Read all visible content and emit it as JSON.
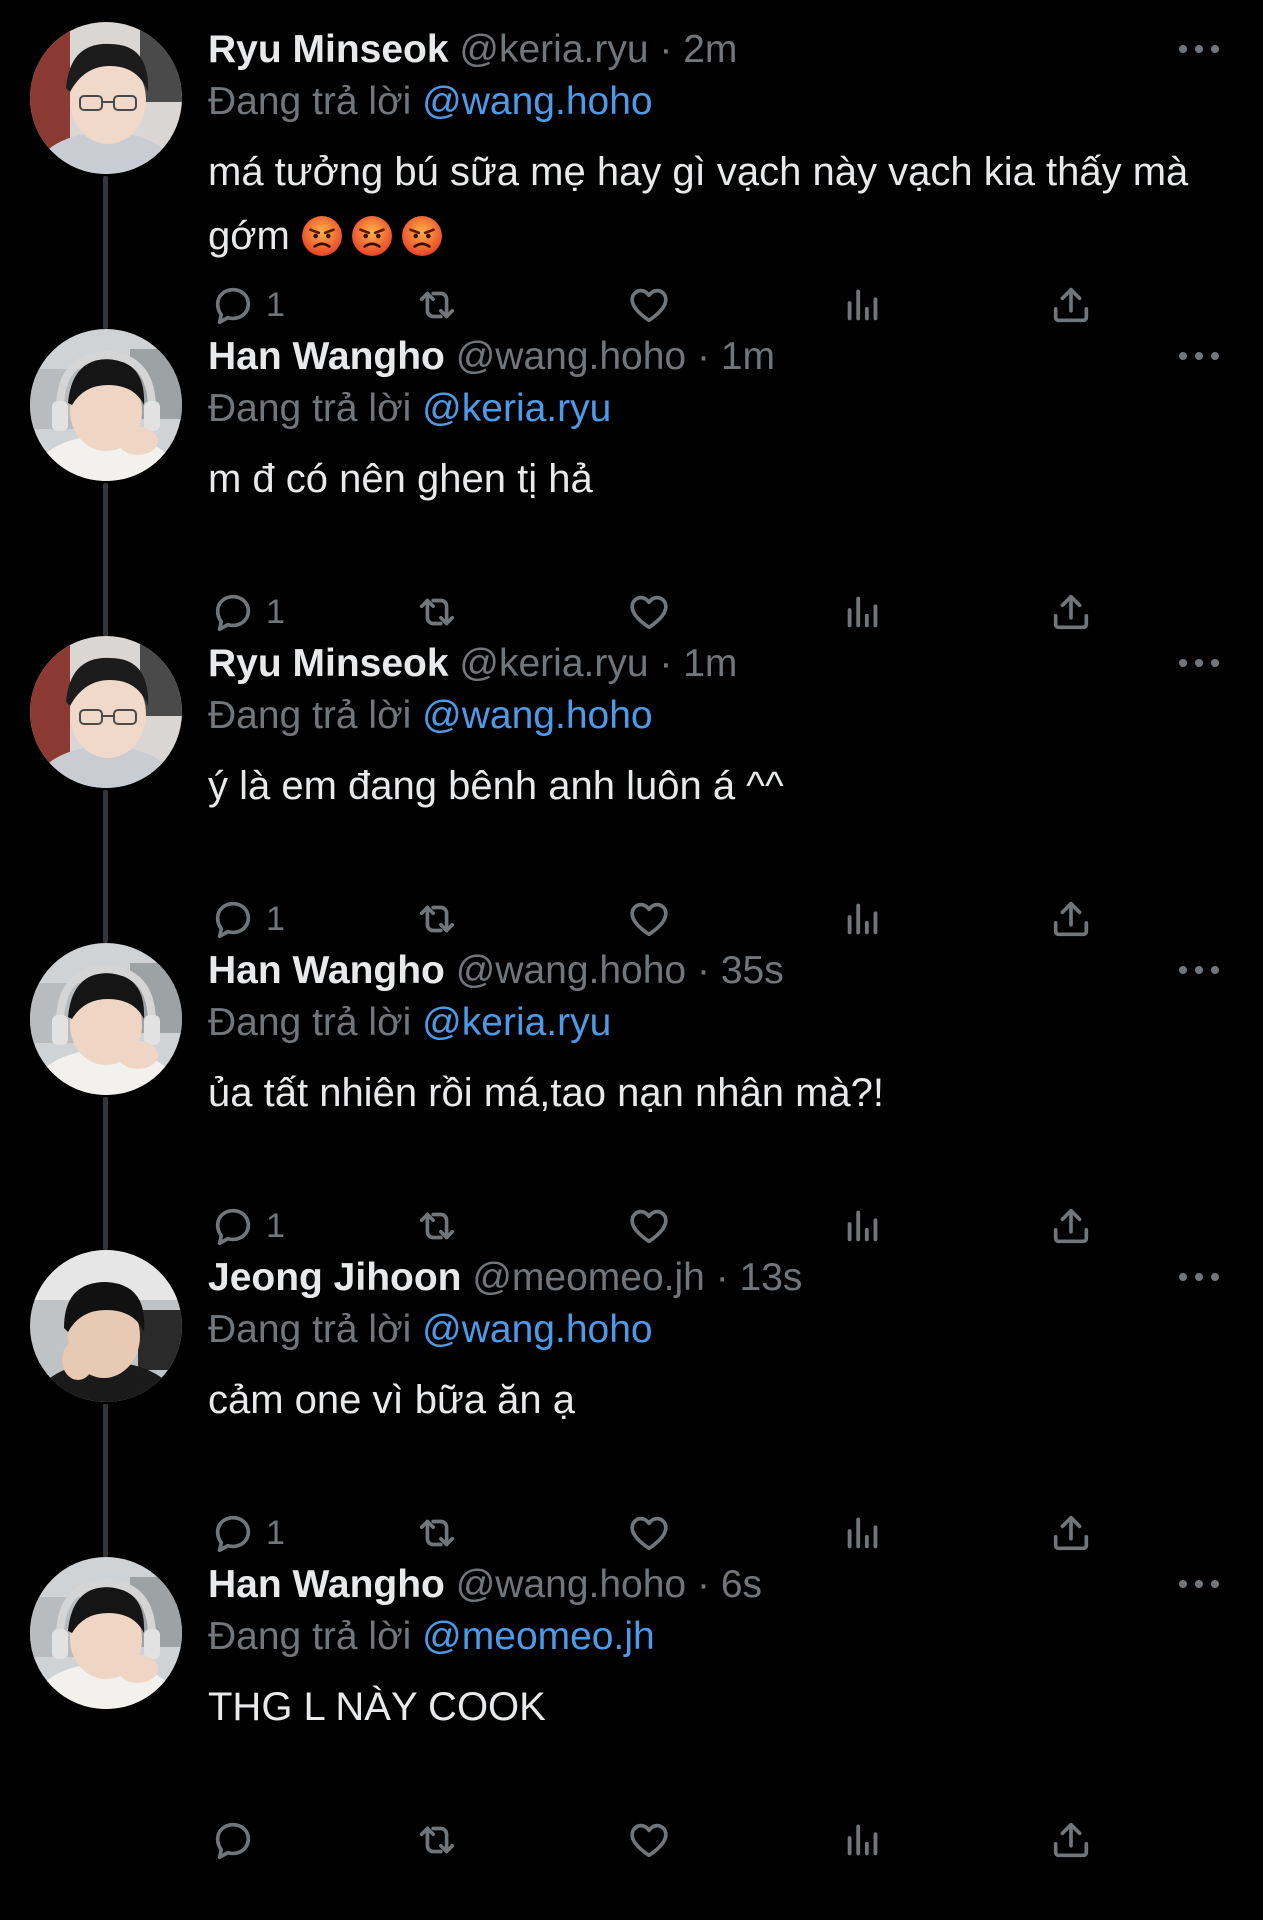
{
  "thread": {
    "tweets": [
      {
        "name": "Ryu Minseok",
        "handle": "@keria.ryu",
        "separator": "·",
        "time": "2m",
        "reply_prefix": "Đang trả lời",
        "reply_to": "@wang.hoho",
        "text": "má tưởng bú sữa mẹ hay gì vạch này vạch kia thấy mà gớm",
        "emoji": [
          "angry-face-emoji",
          "angry-face-emoji",
          "angry-face-emoji"
        ],
        "reply_count": "1",
        "avatar": "avatar-ryu-minseok"
      },
      {
        "name": "Han Wangho",
        "handle": "@wang.hoho",
        "separator": "·",
        "time": "1m",
        "reply_prefix": "Đang trả lời",
        "reply_to": "@keria.ryu",
        "text": "m đ có nên ghen tị hả",
        "emoji": [],
        "reply_count": "1",
        "avatar": "avatar-han-wangho"
      },
      {
        "name": "Ryu Minseok",
        "handle": "@keria.ryu",
        "separator": "·",
        "time": "1m",
        "reply_prefix": "Đang trả lời",
        "reply_to": "@wang.hoho",
        "text": "ý là em đang bênh anh luôn á ^^",
        "emoji": [],
        "reply_count": "1",
        "avatar": "avatar-ryu-minseok"
      },
      {
        "name": "Han Wangho",
        "handle": "@wang.hoho",
        "separator": "·",
        "time": "35s",
        "reply_prefix": "Đang trả lời",
        "reply_to": "@keria.ryu",
        "text": "ủa tất nhiên rồi má,tao nạn nhân mà?!",
        "emoji": [],
        "reply_count": "1",
        "avatar": "avatar-han-wangho"
      },
      {
        "name": "Jeong Jihoon",
        "handle": "@meomeo.jh",
        "separator": "·",
        "time": "13s",
        "reply_prefix": "Đang trả lời",
        "reply_to": "@wang.hoho",
        "text": "cảm one vì bữa ăn ạ",
        "emoji": [],
        "reply_count": "1",
        "avatar": "avatar-jeong-jihoon"
      },
      {
        "name": "Han Wangho",
        "handle": "@wang.hoho",
        "separator": "·",
        "time": "6s",
        "reply_prefix": "Đang trả lời",
        "reply_to": "@meomeo.jh",
        "text": "THG L NÀY COOK",
        "emoji": [],
        "reply_count": "",
        "avatar": "avatar-han-wangho"
      }
    ]
  },
  "icons": {
    "reply": "reply-icon",
    "retweet": "retweet-icon",
    "like": "heart-icon",
    "views": "views-icon",
    "share": "share-icon",
    "more": "more-icon"
  },
  "colors": {
    "background": "#000000",
    "text": "#e7e9ea",
    "muted": "#71767b",
    "mention": "#4d9ae8",
    "thread_line": "#333639"
  }
}
